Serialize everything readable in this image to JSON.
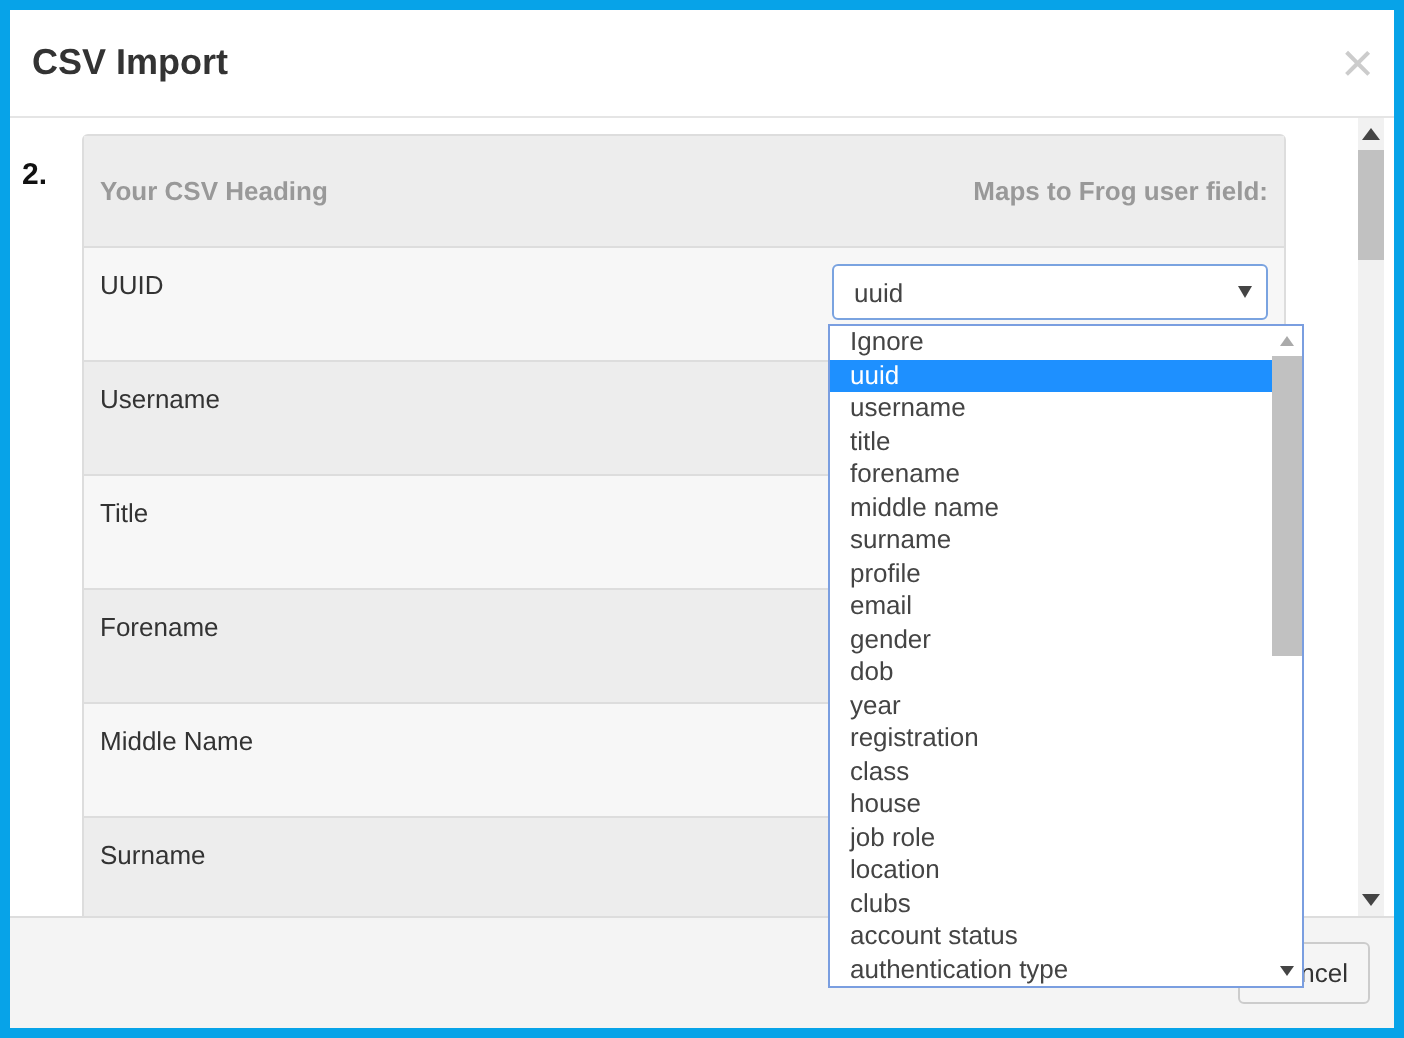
{
  "window": {
    "title": "CSV Import",
    "close": "×"
  },
  "step": "2.",
  "table": {
    "columns": [
      "Your CSV Heading",
      "Maps to Frog user field:"
    ],
    "rows": [
      {
        "heading": "UUID"
      },
      {
        "heading": "Username"
      },
      {
        "heading": "Title"
      },
      {
        "heading": "Forename"
      },
      {
        "heading": "Middle Name"
      },
      {
        "heading": "Surname"
      }
    ]
  },
  "select": {
    "value": "uuid",
    "options": [
      {
        "label": "Ignore",
        "selected": false
      },
      {
        "label": "uuid",
        "selected": true
      },
      {
        "label": "username",
        "selected": false
      },
      {
        "label": "title",
        "selected": false
      },
      {
        "label": "forename",
        "selected": false
      },
      {
        "label": "middle name",
        "selected": false
      },
      {
        "label": "surname",
        "selected": false
      },
      {
        "label": "profile",
        "selected": false
      },
      {
        "label": "email",
        "selected": false
      },
      {
        "label": "gender",
        "selected": false
      },
      {
        "label": "dob",
        "selected": false
      },
      {
        "label": "year",
        "selected": false
      },
      {
        "label": "registration",
        "selected": false
      },
      {
        "label": "class",
        "selected": false
      },
      {
        "label": "house",
        "selected": false
      },
      {
        "label": "job role",
        "selected": false
      },
      {
        "label": "location",
        "selected": false
      },
      {
        "label": "clubs",
        "selected": false
      },
      {
        "label": "account status",
        "selected": false
      },
      {
        "label": "authentication type",
        "selected": false
      }
    ]
  },
  "footer": {
    "button": "ncel"
  }
}
